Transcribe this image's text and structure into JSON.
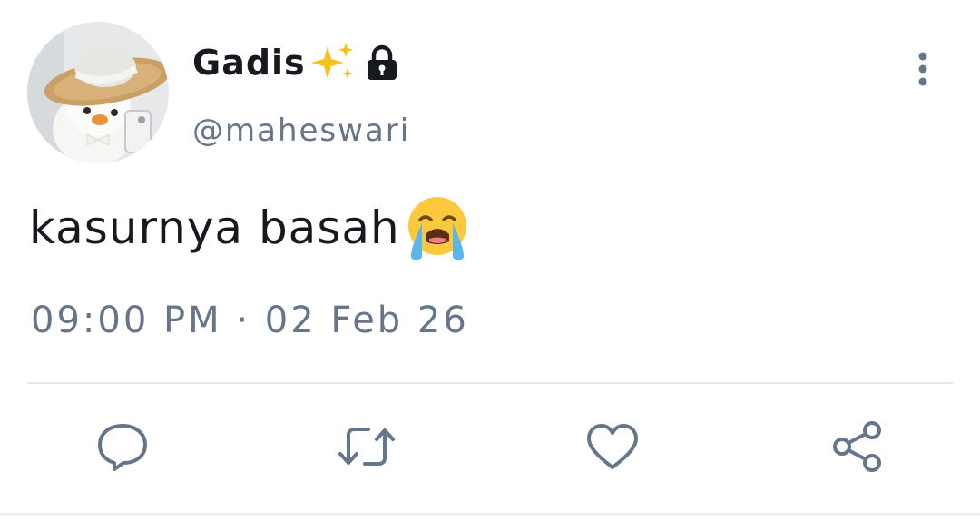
{
  "profile": {
    "display_name": "Gadis",
    "handle": "@maheswari",
    "name_badges": [
      "sparkles-icon",
      "lock-icon"
    ],
    "avatar_icon": "avatar-plush-duck-with-straw-hat"
  },
  "tweet": {
    "text": "kasurnya basah",
    "emoji_icon": "crying-face-icon",
    "timestamp": "09:00 PM · 02 Feb 26"
  },
  "header_actions": {
    "more_icon": "more-vertical-icon"
  },
  "actions": [
    {
      "name": "reply",
      "icon": "comment-bubble-icon"
    },
    {
      "name": "retweet",
      "icon": "retweet-icon"
    },
    {
      "name": "like",
      "icon": "heart-icon"
    },
    {
      "name": "share",
      "icon": "share-icon"
    }
  ],
  "colors": {
    "text_primary": "#16191d",
    "text_secondary": "#66768a",
    "icon": "#66768a",
    "divider": "#e3e6ea",
    "background": "#ffffff"
  }
}
